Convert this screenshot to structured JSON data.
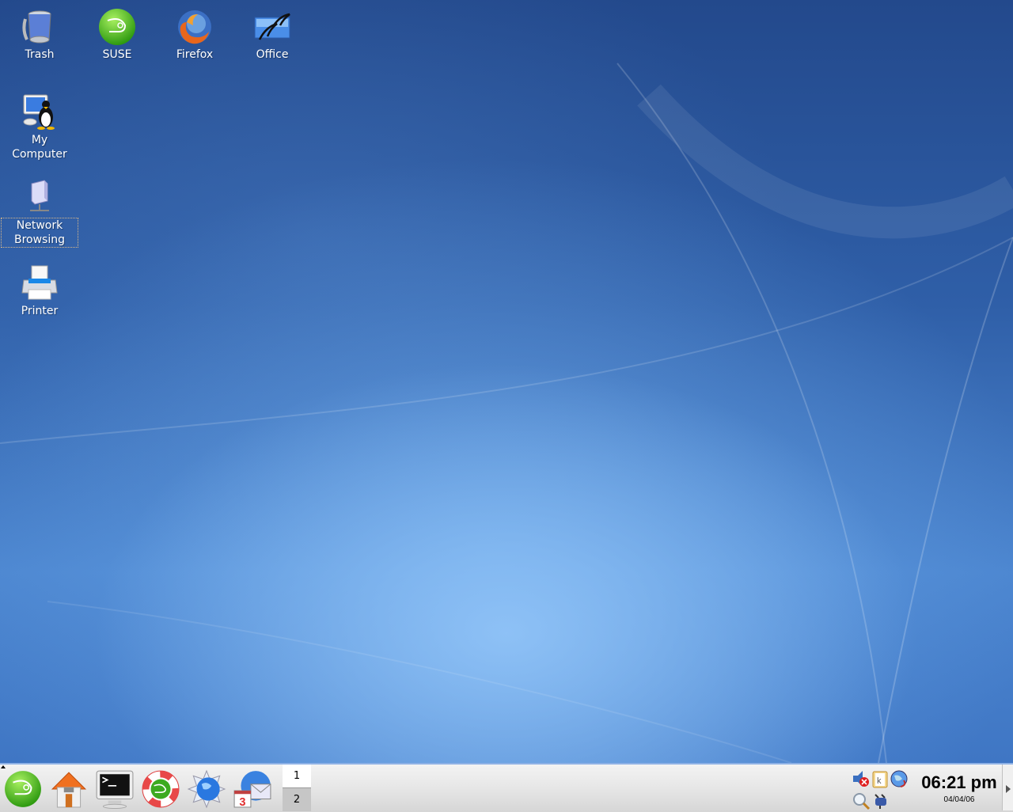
{
  "desktop": {
    "icons": [
      {
        "name": "trash",
        "label": "Trash"
      },
      {
        "name": "suse",
        "label": "SUSE"
      },
      {
        "name": "firefox",
        "label": "Firefox"
      },
      {
        "name": "office",
        "label": "Office"
      },
      {
        "name": "my-computer",
        "label": "My Computer"
      },
      {
        "name": "network-browsing",
        "label": "Network Browsing"
      },
      {
        "name": "printer",
        "label": "Printer"
      }
    ]
  },
  "taskbar": {
    "launchers": [
      {
        "name": "kmenu",
        "icon": "suse-chameleon-icon"
      },
      {
        "name": "home",
        "icon": "home-icon"
      },
      {
        "name": "terminal",
        "icon": "terminal-icon"
      },
      {
        "name": "help",
        "icon": "lifebuoy-icon"
      },
      {
        "name": "konqueror",
        "icon": "web-browser-icon"
      },
      {
        "name": "kontact",
        "icon": "mail-calendar-icon"
      }
    ],
    "pager": {
      "desktops": [
        "1",
        "2"
      ],
      "active": "1"
    },
    "tray": [
      {
        "name": "volume-muted",
        "icon": "speaker-muted-icon"
      },
      {
        "name": "klipper",
        "icon": "clipboard-icon"
      },
      {
        "name": "network",
        "icon": "globe-icon"
      },
      {
        "name": "search",
        "icon": "magnifier-icon"
      },
      {
        "name": "power",
        "icon": "plug-icon"
      }
    ],
    "clock": {
      "time": "06:21 pm",
      "date": "04/04/06"
    }
  }
}
